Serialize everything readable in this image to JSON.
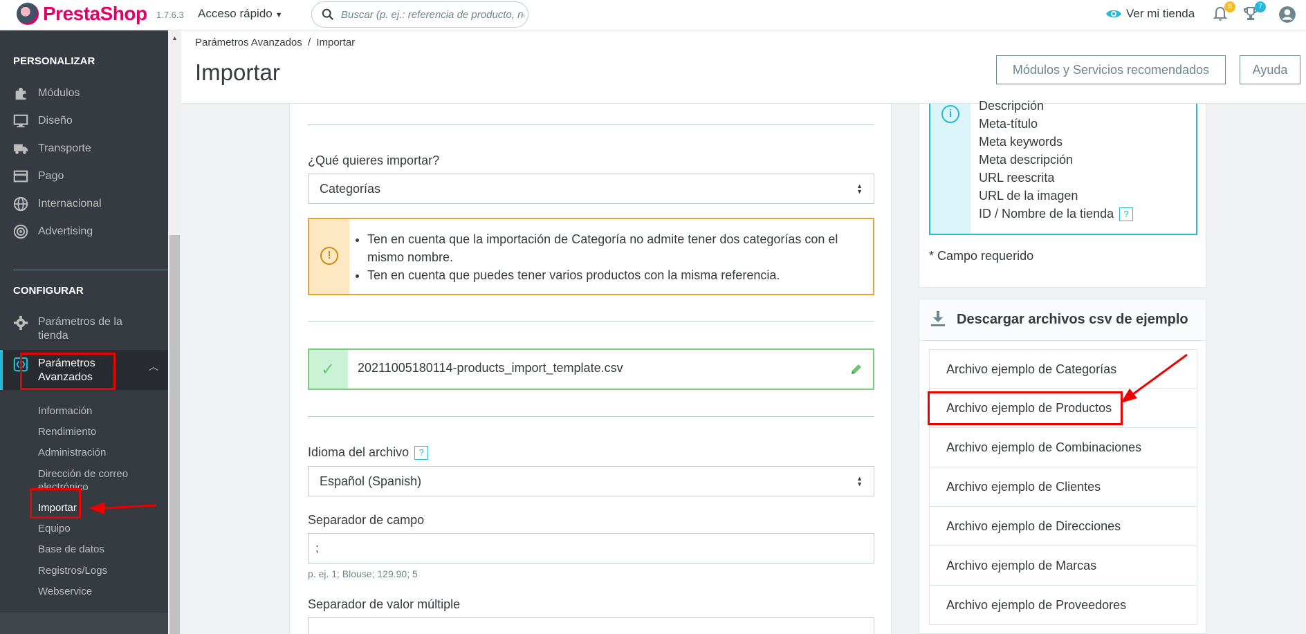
{
  "topbar": {
    "brand": "PrestaShop",
    "version": "1.7.6.3",
    "quick_access": "Acceso rápido",
    "search_placeholder": "Buscar (p. ej.: referencia de producto, nombre de cliente...)",
    "view_shop": "Ver mi tienda",
    "notifications_count": "8",
    "trophy_count": "7",
    "accent": "#25b9d7"
  },
  "sidebar": {
    "sections": {
      "personalizar": "PERSONALIZAR",
      "configurar": "CONFIGURAR"
    },
    "personalizar_items": [
      {
        "label": "Módulos",
        "icon": "puzzle-icon"
      },
      {
        "label": "Diseño",
        "icon": "monitor-icon"
      },
      {
        "label": "Transporte",
        "icon": "truck-icon"
      },
      {
        "label": "Pago",
        "icon": "credit-card-icon"
      },
      {
        "label": "Internacional",
        "icon": "globe-icon"
      },
      {
        "label": "Advertising",
        "icon": "target-icon"
      }
    ],
    "config_shop": "Parámetros de la tienda",
    "config_advanced": "Parámetros Avanzados",
    "sub_items": [
      "Información",
      "Rendimiento",
      "Administración",
      "Dirección de correo electrónico",
      "Importar",
      "Equipo",
      "Base de datos",
      "Registros/Logs",
      "Webservice"
    ]
  },
  "header": {
    "breadcrumb_parent": "Parámetros Avanzados",
    "breadcrumb_sep": "/",
    "breadcrumb_current": "Importar",
    "title": "Importar",
    "recommended_button": "Módulos y Servicios recomendados",
    "help_button": "Ayuda"
  },
  "form": {
    "what_label": "¿Qué quieres importar?",
    "what_value": "Categorías",
    "warnings": [
      "Ten en cuenta que la importación de Categoría no admite tener dos categorías con el mismo nombre.",
      "Ten en cuenta que puedes tener varios productos con la misma referencia."
    ],
    "file_name": "20211005180114-products_import_template.csv",
    "language_label": "Idioma del archivo",
    "language_value": "Español (Spanish)",
    "field_sep_label": "Separador de campo",
    "field_sep_value": ";",
    "field_sep_hint": "p. ej. 1; Blouse; 129.90; 5",
    "multi_sep_label": "Separador de valor múltiple",
    "help_mark": "?"
  },
  "right": {
    "fields": [
      "Descripción",
      "Meta-título",
      "Meta keywords",
      "Meta descripción",
      "URL reescrita",
      "URL de la imagen",
      "ID / Nombre de la tienda"
    ],
    "required_note": "* Campo requerido",
    "download_title": "Descargar archivos csv de ejemplo",
    "samples": [
      "Archivo ejemplo de Categorías",
      "Archivo ejemplo de Productos",
      "Archivo ejemplo de Combinaciones",
      "Archivo ejemplo de Clientes",
      "Archivo ejemplo de Direcciones",
      "Archivo ejemplo de Marcas",
      "Archivo ejemplo de Proveedores"
    ]
  }
}
